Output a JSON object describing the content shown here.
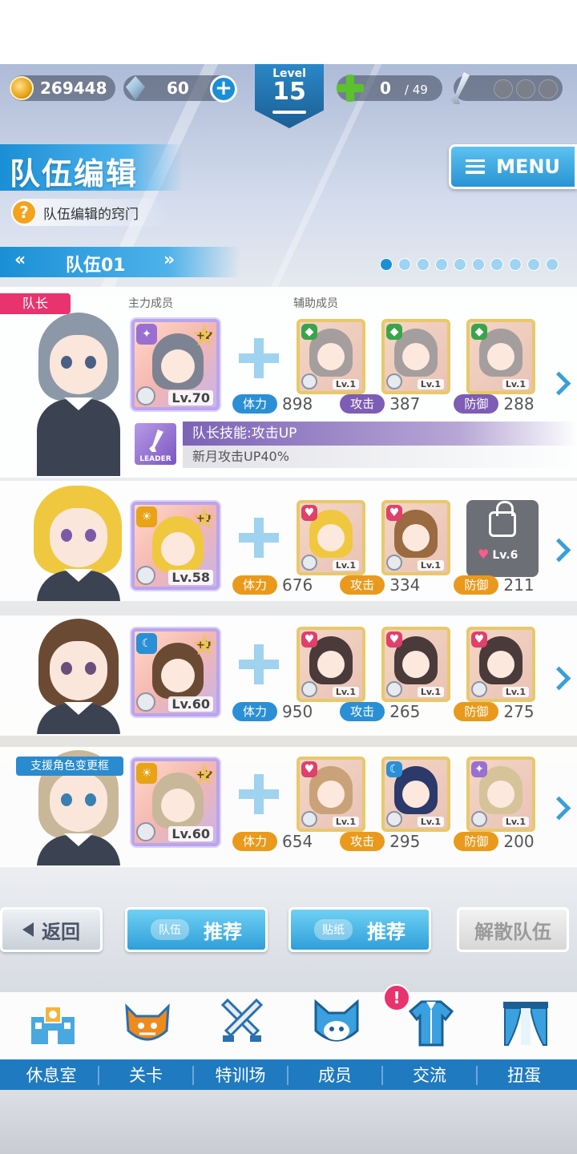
{
  "topbar": {
    "coins": "269448",
    "gems": "60",
    "level_label": "Level",
    "level_value": "15",
    "stamina_current": "0",
    "stamina_max": "/ 49"
  },
  "header": {
    "title": "队伍编辑",
    "hint": "队伍编辑的窍门",
    "menu_label": "MENU"
  },
  "team_selector": {
    "prev": "«",
    "name": "队伍01",
    "next": "»",
    "page_count": 10,
    "current_page": 1
  },
  "section_labels": {
    "main": "主力成员",
    "support": "辅助成员"
  },
  "tags": {
    "leader": "队长",
    "support_change": "支援角色变更框"
  },
  "stat_labels": {
    "hp": "体力",
    "atk": "攻击",
    "def": "防御"
  },
  "teams": [
    {
      "main_level": "Lv.70",
      "main_plus": "+2",
      "sub_levels": [
        "Lv.1",
        "Lv.1",
        "Lv.1"
      ],
      "hp": "898",
      "atk": "387",
      "def": "288"
    },
    {
      "main_level": "Lv.58",
      "main_plus": "+1",
      "sub_levels": [
        "Lv.1",
        "Lv.1"
      ],
      "locked_req": "Lv.6",
      "hp": "676",
      "atk": "334",
      "def": "211"
    },
    {
      "main_level": "Lv.60",
      "main_plus": "+1",
      "sub_levels": [
        "Lv.1",
        "Lv.1",
        "Lv.1"
      ],
      "hp": "950",
      "atk": "265",
      "def": "275"
    },
    {
      "main_level": "Lv.60",
      "main_plus": "+2",
      "sub_levels": [
        "Lv.1",
        "Lv.1",
        "Lv.1"
      ],
      "hp": "654",
      "atk": "295",
      "def": "200"
    }
  ],
  "leader_skill": {
    "icon_label": "LEADER",
    "name": "队长技能:攻击UP",
    "desc": "新月攻击UP40%"
  },
  "buttons": {
    "back": "返回",
    "team_tag": "队伍",
    "team_recommend": "推荐",
    "sticker_tag": "贴纸",
    "sticker_recommend": "推荐",
    "disband": "解散队伍"
  },
  "nav": {
    "items": [
      {
        "label": "休息室",
        "icon": "school-building-icon"
      },
      {
        "label": "关卡",
        "icon": "monster-icon"
      },
      {
        "label": "特训场",
        "icon": "crossed-swords-icon"
      },
      {
        "label": "成员",
        "icon": "cat-mascot-icon"
      },
      {
        "label": "交流",
        "icon": "uniform-icon"
      },
      {
        "label": "扭蛋",
        "icon": "curtain-stage-icon"
      }
    ],
    "alert": "!"
  }
}
